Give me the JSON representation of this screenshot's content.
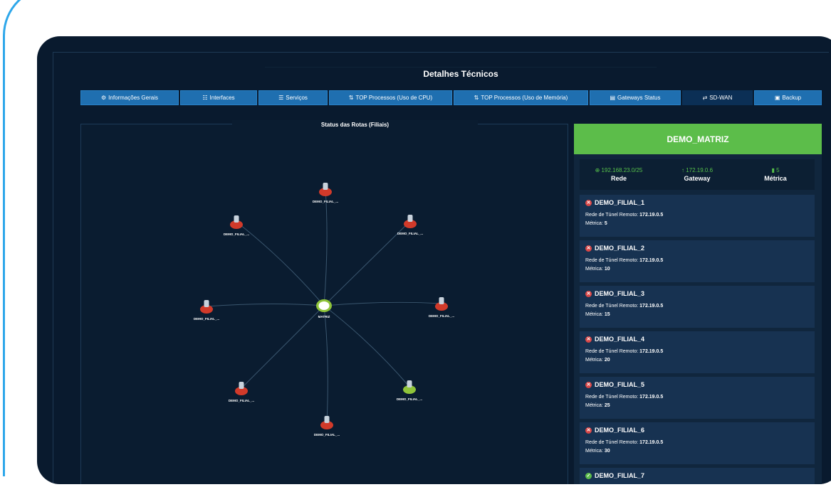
{
  "title": "Detalhes Técnicos",
  "tabs": [
    {
      "icon": "gear-icon",
      "glyph": "⚙",
      "label": "Informações Gerais"
    },
    {
      "icon": "sitemap-icon",
      "glyph": "☷",
      "label": "Interfaces"
    },
    {
      "icon": "list-icon",
      "glyph": "☰",
      "label": "Serviços"
    },
    {
      "icon": "sort-icon",
      "glyph": "⇅",
      "label": "TOP Processos (Uso de CPU)"
    },
    {
      "icon": "sort-icon",
      "glyph": "⇅",
      "label": "TOP Processos (Uso de Memória)"
    },
    {
      "icon": "file-icon",
      "glyph": "▤",
      "label": "Gateways Status"
    },
    {
      "icon": "exchange-icon",
      "glyph": "⇄",
      "label": "SD-WAN"
    },
    {
      "icon": "save-icon",
      "glyph": "▣",
      "label": "Backup"
    }
  ],
  "graph": {
    "title": "Status das Rotas (Filiais)",
    "center": {
      "label": "MATRIZ",
      "status": "up"
    },
    "nodes": [
      {
        "label": "DEMO_FILIAL_...",
        "status": "down"
      },
      {
        "label": "DEMO_FILIAL_...",
        "status": "down"
      },
      {
        "label": "DEMO_FILIAL_...",
        "status": "down"
      },
      {
        "label": "DEMO_FILIAL_...",
        "status": "down"
      },
      {
        "label": "DEMO_FILIAL_...",
        "status": "down"
      },
      {
        "label": "DEMO_FILIAL_...",
        "status": "down"
      },
      {
        "label": "DEMO_FILIAL_...",
        "status": "up"
      },
      {
        "label": "DEMO_FILIAL_...",
        "status": "down"
      }
    ]
  },
  "matriz": {
    "name": "DEMO_MATRIZ",
    "network": {
      "value": "192.168.23.0/25",
      "label": "Rede"
    },
    "gateway": {
      "value": "172.19.0.6",
      "label": "Gateway"
    },
    "metric": {
      "value": "5",
      "label": "Métrica"
    }
  },
  "routes": [
    {
      "name": "DEMO_FILIAL_1",
      "status": "down",
      "tunnel_label": "Rede de Túnel Remoto:",
      "tunnel": "172.19.0.5",
      "metric_label": "Métrica:",
      "metric": "5"
    },
    {
      "name": "DEMO_FILIAL_2",
      "status": "down",
      "tunnel_label": "Rede de Túnel Remoto:",
      "tunnel": "172.19.0.5",
      "metric_label": "Métrica:",
      "metric": "10"
    },
    {
      "name": "DEMO_FILIAL_3",
      "status": "down",
      "tunnel_label": "Rede de Túnel Remoto:",
      "tunnel": "172.19.0.5",
      "metric_label": "Métrica:",
      "metric": "15"
    },
    {
      "name": "DEMO_FILIAL_4",
      "status": "down",
      "tunnel_label": "Rede de Túnel Remoto:",
      "tunnel": "172.19.0.5",
      "metric_label": "Métrica:",
      "metric": "20"
    },
    {
      "name": "DEMO_FILIAL_5",
      "status": "down",
      "tunnel_label": "Rede de Túnel Remoto:",
      "tunnel": "172.19.0.5",
      "metric_label": "Métrica:",
      "metric": "25"
    },
    {
      "name": "DEMO_FILIAL_6",
      "status": "down",
      "tunnel_label": "Rede de Túnel Remoto:",
      "tunnel": "172.19.0.5",
      "metric_label": "Métrica:",
      "metric": "30"
    },
    {
      "name": "DEMO_FILIAL_7",
      "status": "up"
    }
  ],
  "colors": {
    "up": "#8fc43a",
    "down": "#d13a2a",
    "accent": "#5cbd4a",
    "tab": "#1f6fb0"
  }
}
